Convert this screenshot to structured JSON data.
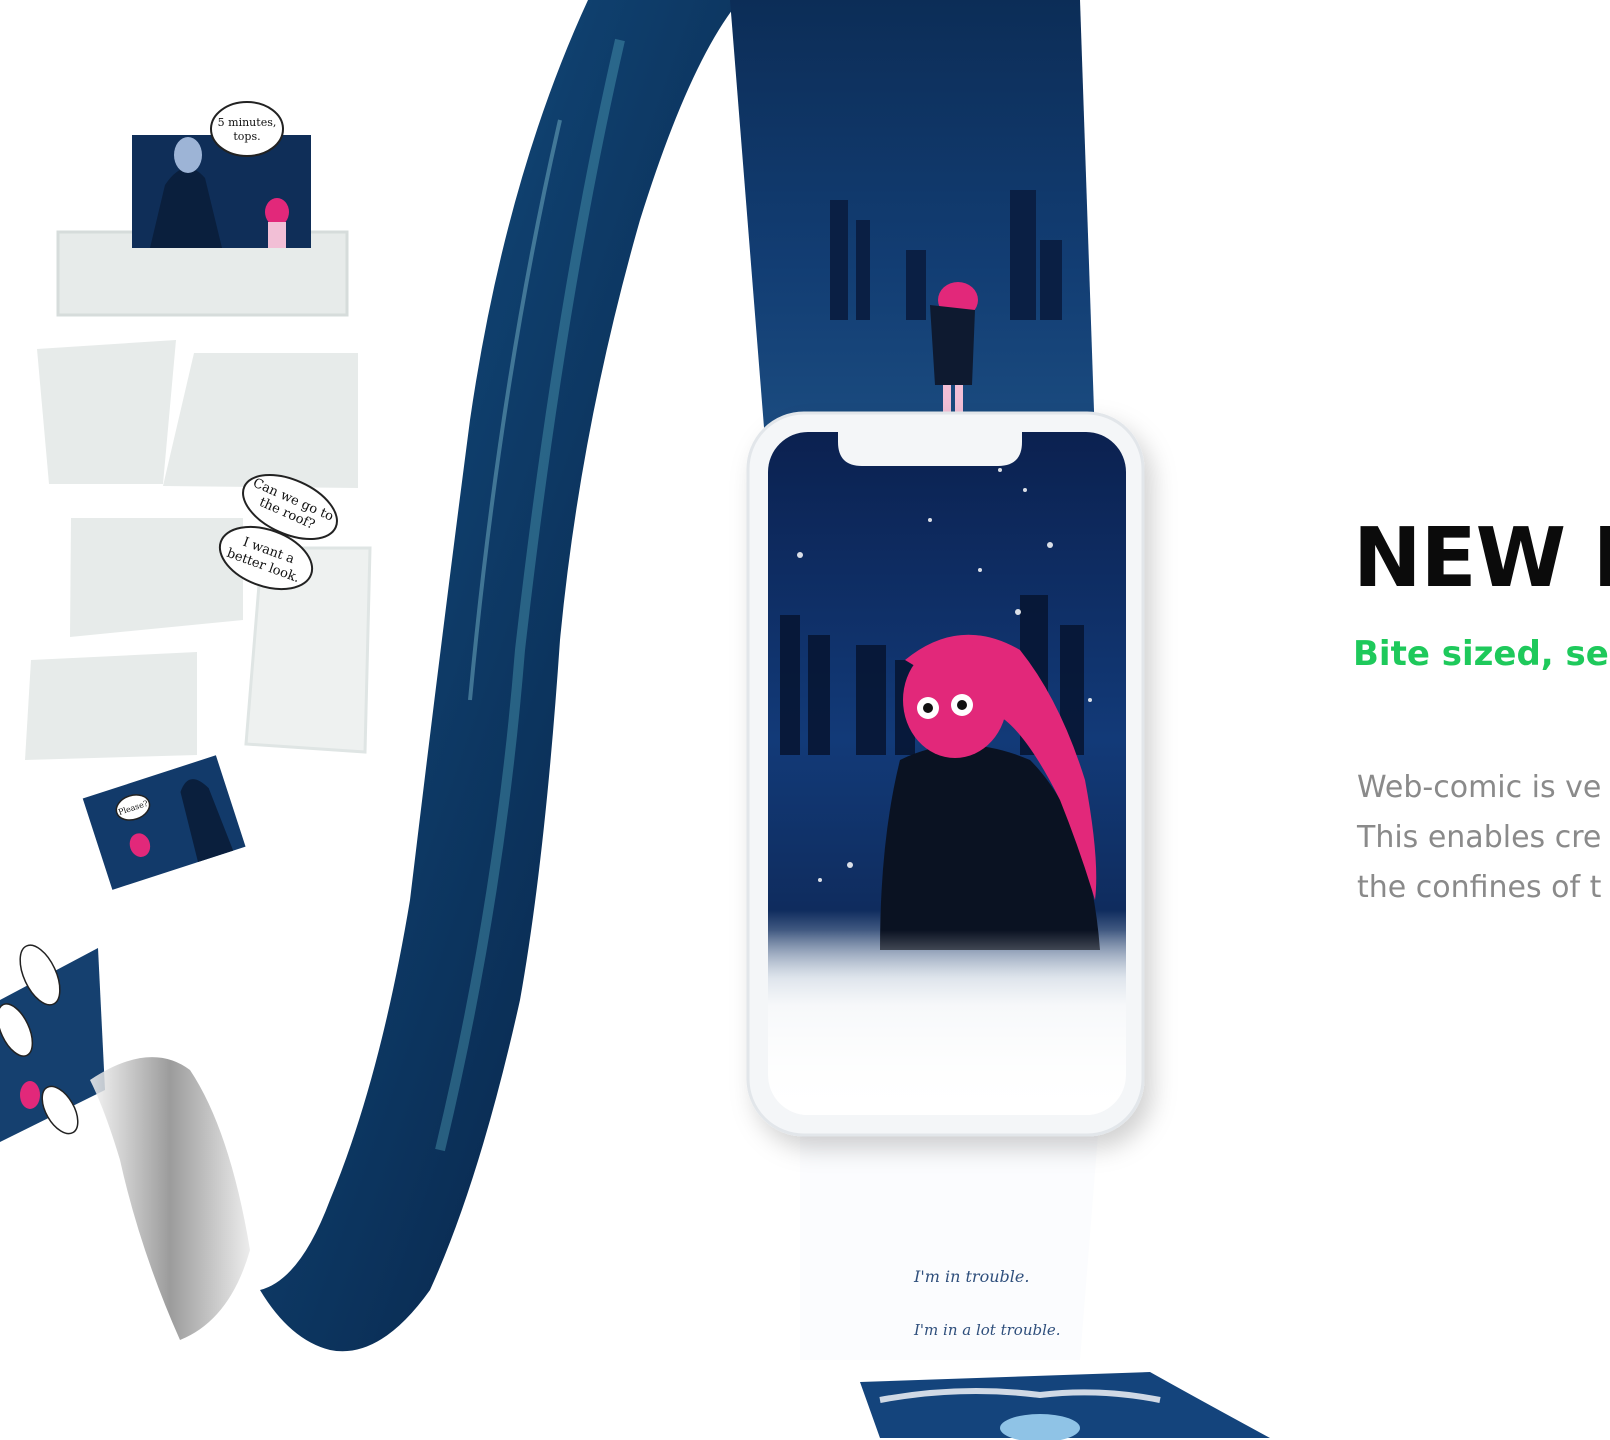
{
  "hero": {
    "headline": "NEW F",
    "subhead": "Bite sized, ser",
    "body_lines": [
      "Web-comic is ve",
      "This enables cre",
      "the confines of t"
    ]
  },
  "comic": {
    "bubble_1": [
      "5 minutes,",
      "tops."
    ],
    "bubble_2": [
      "Can we go to",
      "the roof?"
    ],
    "bubble_3": [
      "I want a",
      "better look."
    ],
    "bubble_4": "Please?",
    "strip_line_1": "I'm in trouble.",
    "strip_line_2": "I'm in a lot trouble."
  },
  "colors": {
    "headline": "#0b0b0b",
    "accent_green": "#1ec95b",
    "body_gray": "#8a8a8a",
    "night_blue": "#0f3a66",
    "character_pink": "#e2287a",
    "panel_gray": "#e7ebea"
  }
}
